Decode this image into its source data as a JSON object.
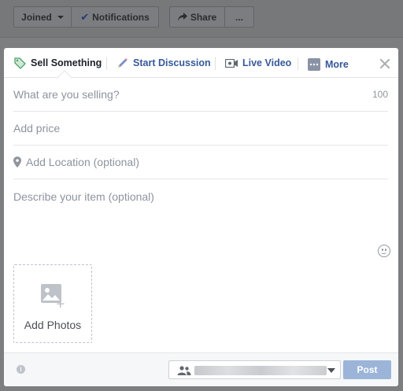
{
  "topbar": {
    "joined_label": "Joined",
    "notifications_label": "Notifications",
    "share_label": "Share",
    "more_label": "..."
  },
  "composer": {
    "tabs": [
      {
        "label": "Sell Something",
        "icon": "tag-icon",
        "active": true
      },
      {
        "label": "Start Discussion",
        "icon": "pencil-icon",
        "active": false
      },
      {
        "label": "Live Video",
        "icon": "video-camera-icon",
        "active": false
      },
      {
        "label": "More",
        "icon": "more-icon",
        "active": false
      }
    ],
    "title_placeholder": "What are you selling?",
    "title_char_limit": "100",
    "price_placeholder": "Add price",
    "location_placeholder": "Add Location (optional)",
    "description_placeholder": "Describe your item (optional)",
    "add_photos_label": "Add Photos",
    "info_icon_text": "i",
    "post_label": "Post"
  },
  "colors": {
    "accent": "#365899",
    "post_disabled": "#9cb4d8",
    "overlay": "#7d7e80"
  }
}
